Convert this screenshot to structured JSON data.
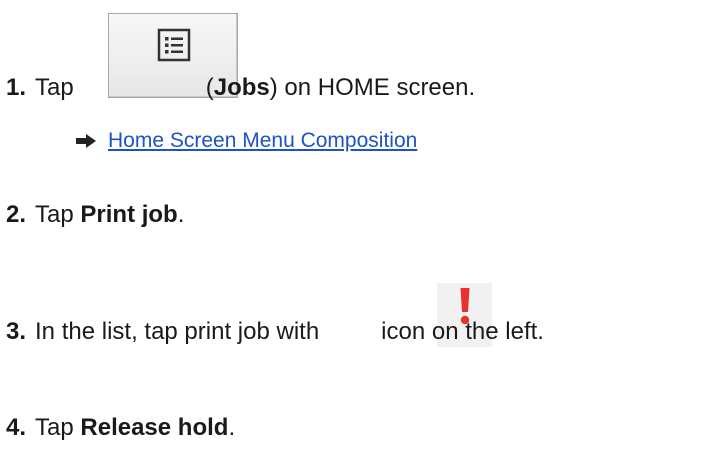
{
  "steps": [
    {
      "number": "1.",
      "before": "Tap",
      "icon": "jobs-list-icon",
      "bold": "Jobs",
      "after": "on HOME screen.",
      "link": {
        "icon": "right-arrow-icon",
        "text": "Home Screen Menu Composition"
      }
    },
    {
      "number": "2.",
      "before": "Tap",
      "bold": "Print job",
      "after": "."
    },
    {
      "number": "3.",
      "before": "In the list, tap print job with",
      "icon": "exclamation-alert-icon",
      "after": "icon on the left."
    },
    {
      "number": "4.",
      "before": "Tap",
      "bold": "Release hold",
      "after": "."
    }
  ],
  "colors": {
    "link": "#1f52c4",
    "alert": "#e8322d",
    "text": "#1a1a1a"
  }
}
